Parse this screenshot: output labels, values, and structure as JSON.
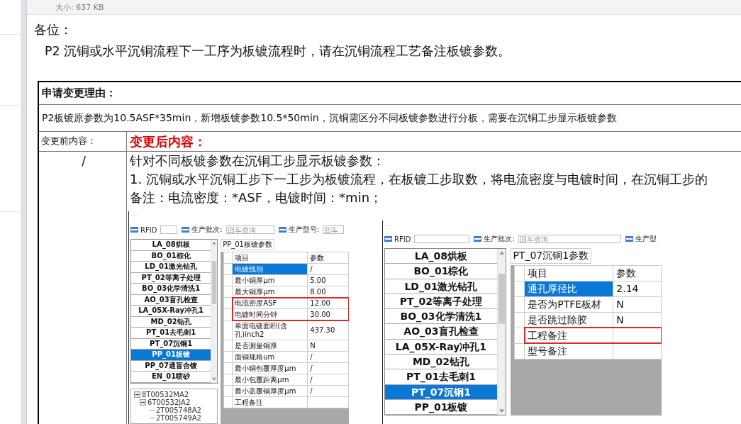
{
  "attachment": {
    "size": "大小: 637 KB"
  },
  "greeting": "各位：",
  "intro": "P2 沉铜或水平沉铜流程下一工序为板镀流程时，请在沉铜流程工艺备注板镀参数。",
  "form": {
    "reason_label": "申请变更理由：",
    "reason": "P2板镀原参数为10.5ASF*35min，新增板镀参数10.5*50min，沉铜需区分不同板镀参数进行分板，需要在沉铜工步显示板镀参数",
    "before_label": "变更前内容：",
    "after_label": "变更后内容：",
    "before": "/",
    "after_lines": [
      "针对不同板镀参数在沉铜工步显示板镀参数：",
      "1. 沉铜或水平沉铜工步下一工步为板镀流程，在板镀工步取数，将电流密度与电镀时间，在沉铜工步的",
      "备注：电流密度：*ASF，电镀时间：*min；"
    ],
    "screenshots": [
      {
        "filters": [
          {
            "kind": "field",
            "label": "RFID"
          },
          {
            "kind": "field",
            "label": "生产批次:",
            "placeholder": "回车查询"
          },
          {
            "kind": "field",
            "label": "生产型号:",
            "placeholder": "回车"
          }
        ],
        "steps": [
          {
            "label": "LA_08烘板",
            "selected": false
          },
          {
            "label": "BO_01棕化",
            "selected": false
          },
          {
            "label": "LD_01激光钻孔",
            "selected": false
          },
          {
            "label": "PT_02等离子处理",
            "selected": false
          },
          {
            "label": "BO_03化学清洗1",
            "selected": false
          },
          {
            "label": "AO_03盲孔检查",
            "selected": false
          },
          {
            "label": "LA_05X-Ray冲孔1",
            "selected": false
          },
          {
            "label": "MD_02钻孔",
            "selected": false
          },
          {
            "label": "PT_01去毛刺1",
            "selected": false
          },
          {
            "label": "PT_07沉铜1",
            "selected": false
          },
          {
            "label": "PP_01板镀",
            "selected": true
          },
          {
            "label": "PP_07通盲合镀",
            "selected": false
          },
          {
            "label": "EN_01喷砂",
            "selected": false
          }
        ],
        "tab": "PP_01板镀参数",
        "columns": [
          "项目",
          "参数"
        ],
        "rows": [
          {
            "item": "电镀线别",
            "value": "/",
            "selected": true,
            "highlighted": false
          },
          {
            "item": "最小铜厚μm",
            "value": "5.00",
            "selected": false,
            "highlighted": false
          },
          {
            "item": "最大铜厚μm",
            "value": "8.00",
            "selected": false,
            "highlighted": false
          },
          {
            "item": "电流密度ASF",
            "value": "12.00",
            "selected": false,
            "highlighted": true
          },
          {
            "item": "电镀时间分钟",
            "value": "30.00",
            "selected": false,
            "highlighted": true
          },
          {
            "item": "单面电镀面积(含孔)inch2",
            "value": "437.30",
            "selected": false,
            "highlighted": false
          },
          {
            "item": "是否测量铜厚",
            "value": "N",
            "selected": false,
            "highlighted": false
          },
          {
            "item": "面铜规格um",
            "value": "/",
            "selected": false,
            "highlighted": false
          },
          {
            "item": "最小铜包覆厚度μm",
            "value": "/",
            "selected": false,
            "highlighted": false
          },
          {
            "item": "最小包覆距离μm",
            "value": "/",
            "selected": false,
            "highlighted": false
          },
          {
            "item": "最小盖覆铜厚度μm",
            "value": "/",
            "selected": false,
            "highlighted": false
          },
          {
            "item": "工程备注",
            "selected": false,
            "highlighted": false
          }
        ],
        "tree": [
          {
            "label": "8T00532MA2",
            "expanded": true,
            "children": [
              {
                "label": "6T00532JA2",
                "expanded": true,
                "children": [
                  {
                    "label": "2T005748A2"
                  },
                  {
                    "label": "2T005749A2"
                  }
                ]
              }
            ]
          }
        ]
      },
      {
        "filters": [
          {
            "kind": "field",
            "label": "RFID"
          },
          {
            "kind": "field",
            "label": "生产批次:",
            "placeholder": "回车查询"
          },
          {
            "kind": "label",
            "label": "生产型"
          }
        ],
        "steps": [
          {
            "label": "LA_08烘板",
            "selected": false
          },
          {
            "label": "BO_01棕化",
            "selected": false
          },
          {
            "label": "LD_01激光钻孔",
            "selected": false
          },
          {
            "label": "PT_02等离子处理",
            "selected": false
          },
          {
            "label": "BO_03化学清洗1",
            "selected": false
          },
          {
            "label": "AO_03盲孔检查",
            "selected": false
          },
          {
            "label": "LA_05X-Ray冲孔1",
            "selected": false
          },
          {
            "label": "MD_02钻孔",
            "selected": false
          },
          {
            "label": "PT_01去毛刺1",
            "selected": false
          },
          {
            "label": "PT_07沉铜1",
            "selected": true
          },
          {
            "label": "PP_01板镀",
            "selected": false
          }
        ],
        "tab": "PT_07沉铜1参数",
        "columns": [
          "项目",
          "参数"
        ],
        "rows": [
          {
            "item": "通孔厚径比",
            "value": "2.14",
            "selected": true,
            "highlighted": false
          },
          {
            "item": "是否为PTFE板材",
            "value": "N",
            "selected": false,
            "highlighted": false
          },
          {
            "item": "是否跳过除胶",
            "value": "N",
            "selected": false,
            "highlighted": false
          },
          {
            "item": "工程备注",
            "selected": false,
            "highlighted": true
          },
          {
            "item": "型号备注",
            "selected": false,
            "highlighted": false
          }
        ]
      }
    ]
  }
}
